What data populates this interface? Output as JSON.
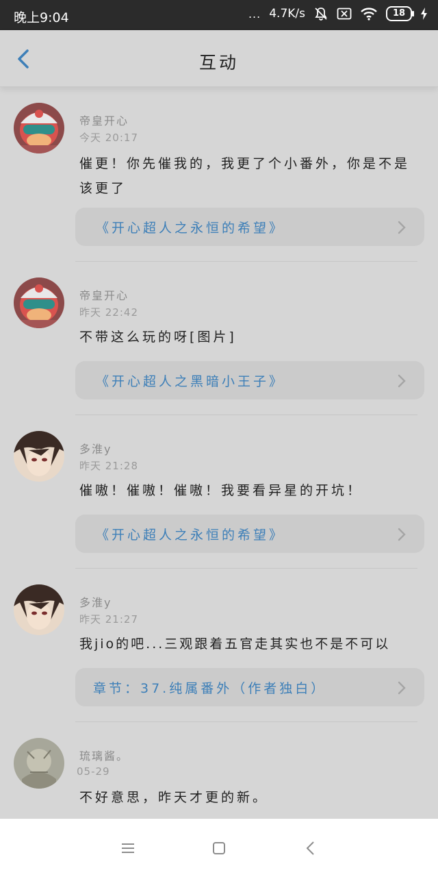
{
  "status": {
    "time": "晚上9:04",
    "dots": "...",
    "speed": "4.7K/s",
    "battery": "18"
  },
  "header": {
    "title": "互动"
  },
  "items": [
    {
      "username": "帝皇开心",
      "time": "今天 20:17",
      "content": "催更！你先催我的，我更了个小番外，你是不是该更了",
      "link": "《开心超人之永恒的希望》"
    },
    {
      "username": "帝皇开心",
      "time": "昨天 22:42",
      "content": "不带这么玩的呀[图片]",
      "link": "《开心超人之黑暗小王子》"
    },
    {
      "username": "多淮y",
      "time": "昨天 21:28",
      "content": "催嗷！催嗷！催嗷！我要看异星的开坑！",
      "link": "《开心超人之永恒的希望》"
    },
    {
      "username": "多淮y",
      "time": "昨天 21:27",
      "content": "我jio的吧...三观跟着五官走其实也不是不可以",
      "link": "章节：37.纯属番外（作者独白）"
    },
    {
      "username": "琉璃酱。",
      "time": "05-29",
      "content": "不好意思，昨天才更的新。"
    }
  ]
}
